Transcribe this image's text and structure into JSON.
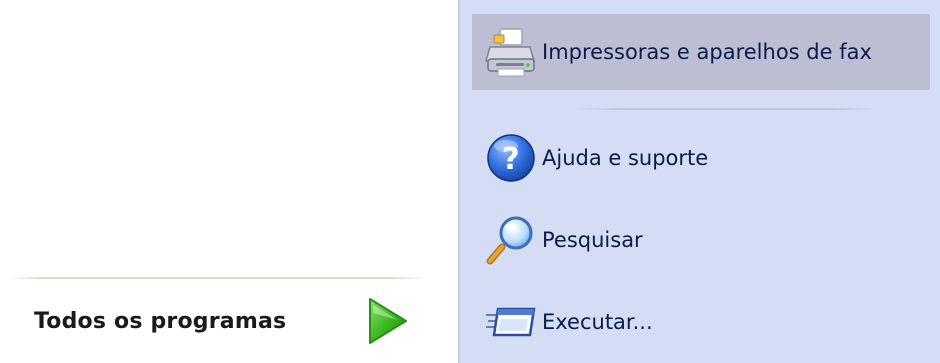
{
  "left": {
    "all_programs_label": "Todos os programas",
    "play_icon": "green-arrow-icon"
  },
  "right": {
    "items": [
      {
        "label": "Impressoras e aparelhos de fax",
        "icon": "printer-icon",
        "highlighted": true
      },
      {
        "label": "Ajuda e suporte",
        "icon": "help-icon",
        "highlighted": false
      },
      {
        "label": "Pesquisar",
        "icon": "search-icon",
        "highlighted": false
      },
      {
        "label": "Executar...",
        "icon": "run-icon",
        "highlighted": false
      }
    ]
  },
  "colors": {
    "right_panel_bg": "#d4ddf4",
    "highlight_bg": "#bdbdd3",
    "text": "#0b1b4a",
    "arrow_green": "#32b51f"
  }
}
